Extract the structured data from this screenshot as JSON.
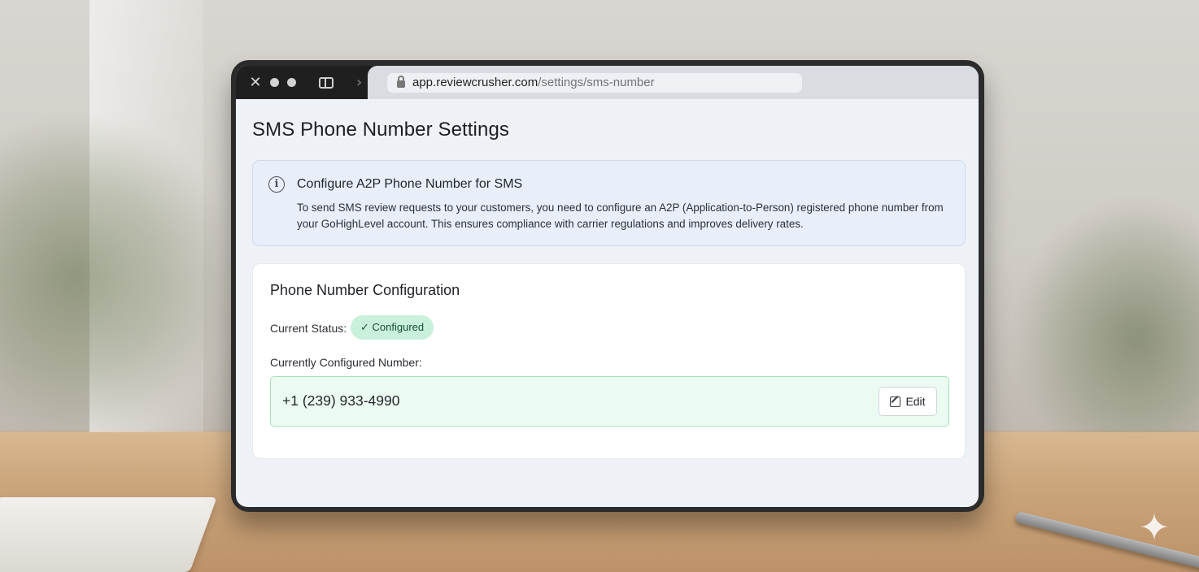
{
  "browser": {
    "url_host": "app.reviewcrusher.com",
    "url_path": "/settings/sms-number"
  },
  "page": {
    "title": "SMS Phone Number Settings"
  },
  "info": {
    "title": "Configure A2P Phone Number for SMS",
    "text": "To send SMS review requests to your customers, you need to configure an A2P (Application-to-Person) registered phone number from your GoHighLevel account. This ensures compliance with carrier regulations and improves delivery rates."
  },
  "config": {
    "title": "Phone Number Configuration",
    "status_label": "Current Status:",
    "status_value": "✓ Configured",
    "number_label": "Currently Configured Number:",
    "number_value": "+1 (239) 933-4990",
    "edit_label": "Edit"
  },
  "colors": {
    "status_badge_bg": "#c8f0da",
    "number_box_bg": "#ecfbf1",
    "info_box_bg": "#e9effa"
  }
}
